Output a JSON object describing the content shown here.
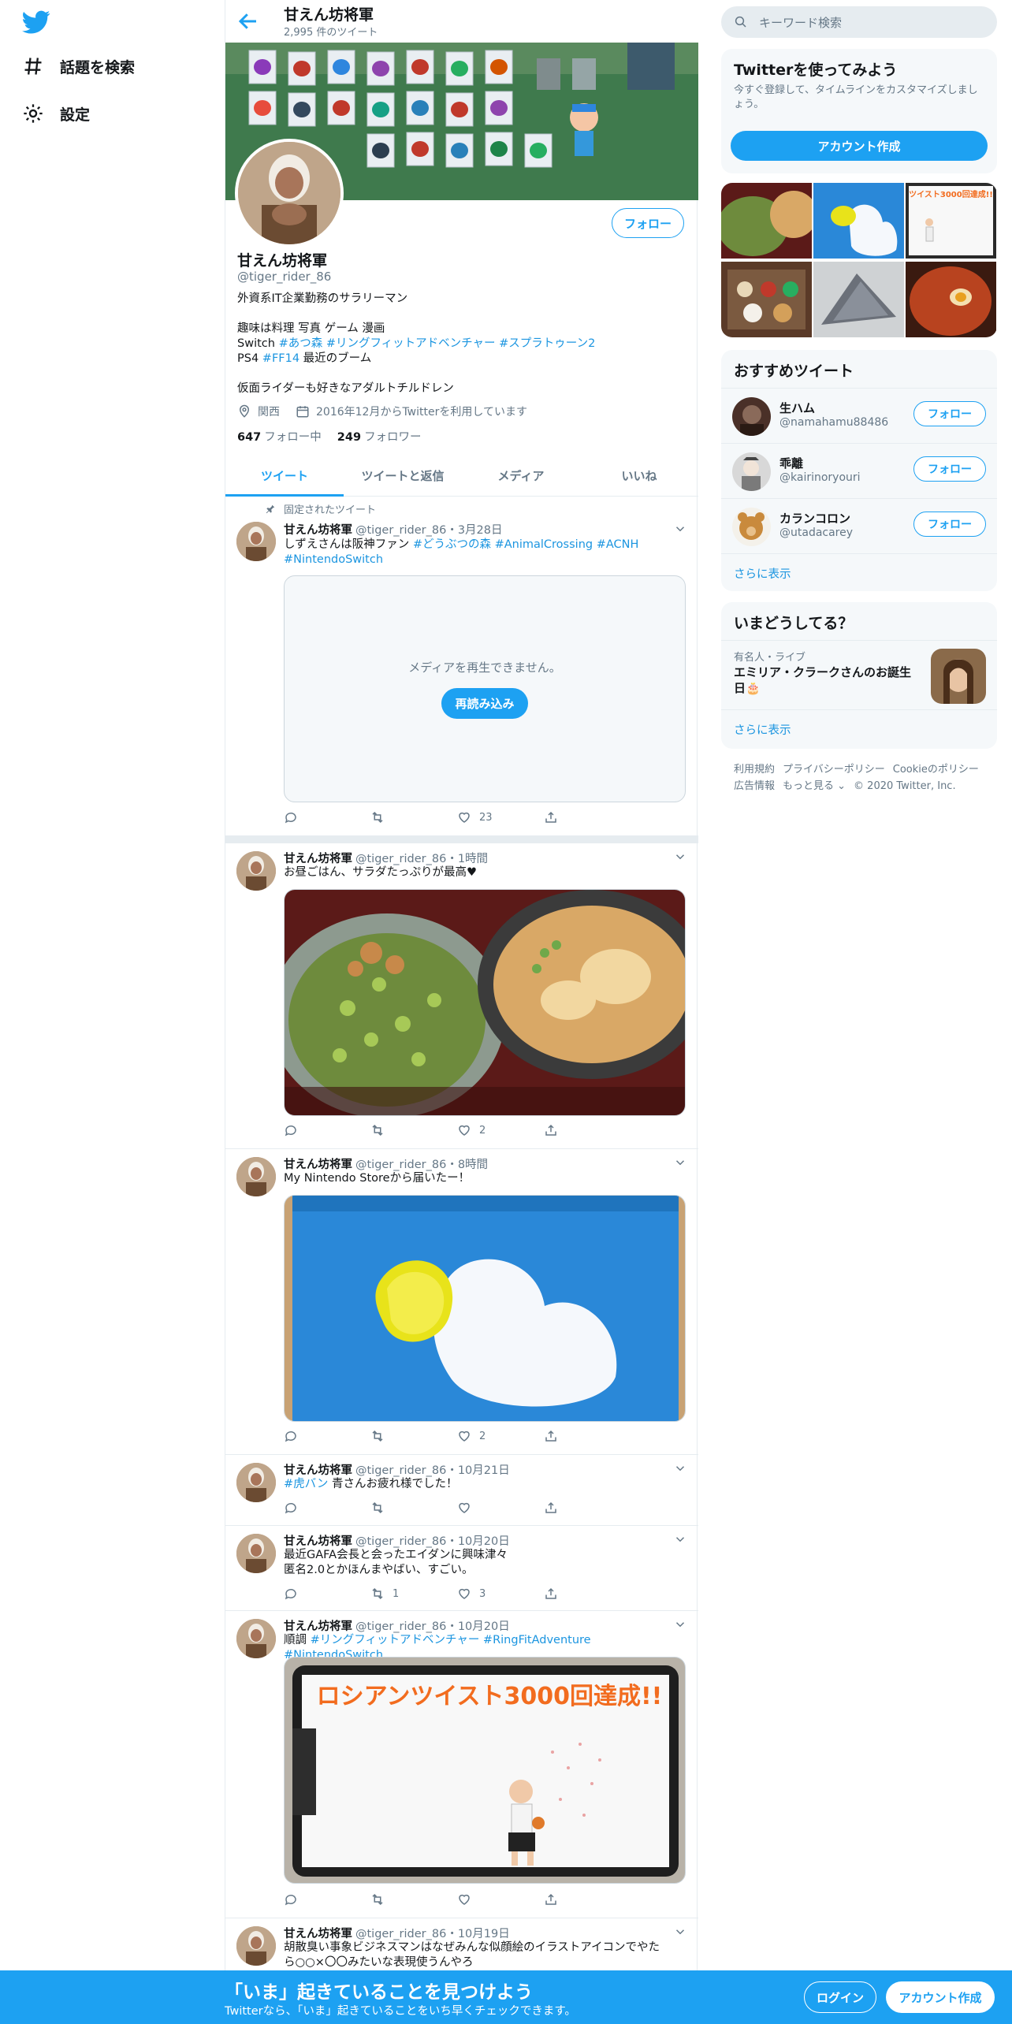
{
  "nav": {
    "items": [
      {
        "label": "話題を検索",
        "icon": "hashtag-icon"
      },
      {
        "label": "設定",
        "icon": "gear-icon"
      }
    ]
  },
  "header": {
    "name": "甘えん坊将軍",
    "tweet_count": "2,995 件のツイート"
  },
  "profile": {
    "name": "甘えん坊将軍",
    "handle": "@tiger_rider_86",
    "follow_label": "フォロー",
    "bio": {
      "line1": "外資系IT企業勤務のサラリーマン",
      "line2": "趣味は料理 写真 ゲーム 漫画",
      "line3_prefix": "Switch ",
      "line3_tags": "#あつ森 #リングフィットアドベンチャー #スプラトゥーン2",
      "line4_prefix": "PS4 ",
      "line4_tag": "#FF14",
      "line4_suffix": " 最近のブーム",
      "line5": "仮面ライダーも好きなアダルトチルドレン"
    },
    "location": "関西",
    "joined": "2016年12月からTwitterを利用しています",
    "following_count": "647",
    "following_label": "フォロー中",
    "followers_count": "249",
    "followers_label": "フォロワー"
  },
  "tabs": [
    {
      "label": "ツイート",
      "active": true
    },
    {
      "label": "ツイートと返信",
      "active": false
    },
    {
      "label": "メディア",
      "active": false
    },
    {
      "label": "いいね",
      "active": false
    }
  ],
  "tweets": [
    {
      "pinned_label": "固定されたツイート",
      "name": "甘えん坊将軍",
      "handle": "@tiger_rider_86",
      "time": "・3月28日",
      "text_plain": "しずえさんは阪神ファン ",
      "text_tags": "#どうぶつの森 #AnimalCrossing #ACNH",
      "text_tags2": "#NintendoSwitch",
      "media_error": "メディアを再生できません。",
      "reload_label": "再読み込み",
      "likes": "23"
    },
    {
      "name": "甘えん坊将軍",
      "handle": "@tiger_rider_86",
      "time": "・1時間",
      "text": "お昼ごはん、サラダたっぷりが最高♥",
      "likes": "2"
    },
    {
      "name": "甘えん坊将軍",
      "handle": "@tiger_rider_86",
      "time": "・8時間",
      "text": "My Nintendo Storeから届いたー！",
      "likes": "2"
    },
    {
      "name": "甘えん坊将軍",
      "handle": "@tiger_rider_86",
      "time": "・10月21日",
      "text_tag": "#虎バン",
      "text_suffix": " 青さんお疲れ様でした！"
    },
    {
      "name": "甘えん坊将軍",
      "handle": "@tiger_rider_86",
      "time": "・10月20日",
      "text_line1": "最近GAFA会長と会ったエイダンに興味津々",
      "text_line2": "匿名2.0とかほんまやばい、すごい。",
      "retweets": "1",
      "likes": "3"
    },
    {
      "name": "甘えん坊将軍",
      "handle": "@tiger_rider_86",
      "time": "・10月20日",
      "text_prefix": "順調 ",
      "text_tags": "#リングフィットアドベンチャー #RingFitAdventure #NintendoSwitch",
      "media_caption": "ロシアンツイスト3000回達成!!"
    },
    {
      "name": "甘えん坊将軍",
      "handle": "@tiger_rider_86",
      "time": "・10月19日",
      "text_line1": "胡散臭い事象ビジネスマンはなぜみんな似顔絵のイラストアイコンでやた",
      "text_line2": "ら○○×〇〇みたいな表現使うんやろ"
    }
  ],
  "search": {
    "placeholder": "キーワード検索"
  },
  "signup_card": {
    "title": "Twitterを使ってみよう",
    "subtitle": "今すぐ登録して、タイムラインをカスタマイズしましょう。",
    "button": "アカウント作成"
  },
  "gallery": {
    "caption": "ツイスト3000回達成!!"
  },
  "recommended": {
    "title": "おすすめツイート",
    "users": [
      {
        "name": "生ハム",
        "handle": "@namahamu88486",
        "follow": "フォロー"
      },
      {
        "name": "乖離",
        "handle": "@kairinoryouri",
        "follow": "フォロー"
      },
      {
        "name": "カランコロン",
        "handle": "@utadacarey",
        "follow": "フォロー"
      }
    ],
    "more": "さらに表示"
  },
  "trends": {
    "title": "いまどうしてる？",
    "category": "有名人・ライブ",
    "headline": "エミリア・クラークさんのお誕生日🎂",
    "more": "さらに表示"
  },
  "footer": {
    "links": [
      "利用規約",
      "プライバシーポリシー",
      "Cookieのポリシー",
      "広告情報",
      "もっと見る ⌄",
      "© 2020 Twitter, Inc."
    ]
  },
  "bottom_bar": {
    "title": "「いま」起きていることを見つけよう",
    "subtitle": "Twitterなら、「いま」起きていることをいち早くチェックできます。",
    "login": "ログイン",
    "signup": "アカウント作成"
  },
  "colors": {
    "accent": "#1da1f2",
    "link": "#1b95e0",
    "muted": "#657786",
    "like_heart": "#e0245e"
  }
}
